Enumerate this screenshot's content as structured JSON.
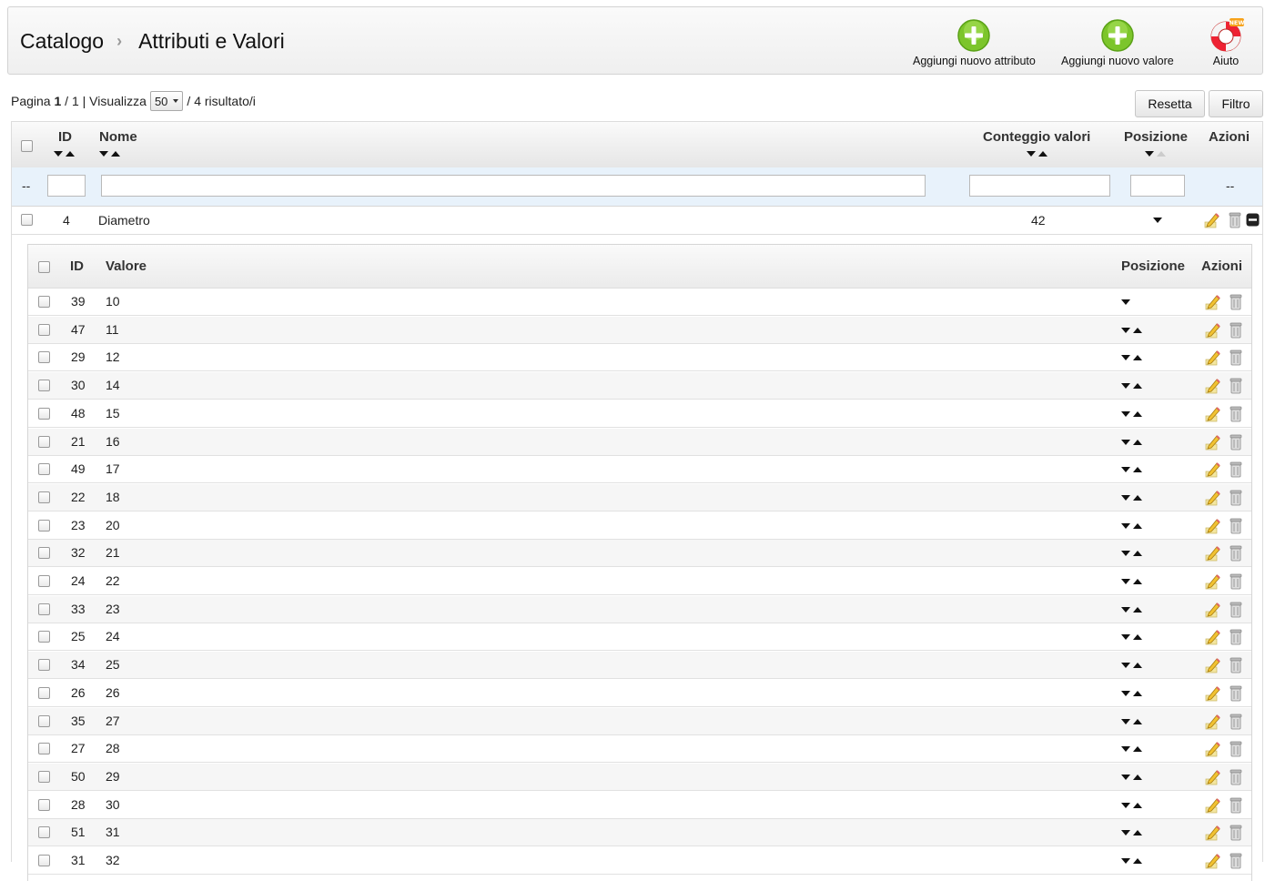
{
  "breadcrumb": {
    "section": "Catalogo",
    "page": "Attributi e Valori"
  },
  "toolbar": {
    "add_attribute": "Aggiungi nuovo attributo",
    "add_value": "Aggiungi nuovo valore",
    "help": "Aiuto",
    "help_badge": "NEW"
  },
  "pager": {
    "page_label": "Pagina",
    "page": "1",
    "total_pages": "/ 1",
    "view_label": "| Visualizza",
    "per_page": "50",
    "results": "/ 4 risultato/i"
  },
  "buttons": {
    "reset": "Resetta",
    "filter": "Filtro"
  },
  "grid": {
    "columns": {
      "id": "ID",
      "name": "Nome",
      "count": "Conteggio valori",
      "position": "Posizione",
      "actions": "Azioni"
    },
    "filter_placeholder_dash": "--",
    "actions_dash": "--",
    "row": {
      "id": "4",
      "name": "Diametro",
      "count": "42"
    }
  },
  "values_grid": {
    "columns": {
      "id": "ID",
      "value": "Valore",
      "position": "Posizione",
      "actions": "Azioni"
    },
    "rows": [
      {
        "id": "39",
        "value": "10"
      },
      {
        "id": "47",
        "value": "11"
      },
      {
        "id": "29",
        "value": "12"
      },
      {
        "id": "30",
        "value": "14"
      },
      {
        "id": "48",
        "value": "15"
      },
      {
        "id": "21",
        "value": "16"
      },
      {
        "id": "49",
        "value": "17"
      },
      {
        "id": "22",
        "value": "18"
      },
      {
        "id": "23",
        "value": "20"
      },
      {
        "id": "32",
        "value": "21"
      },
      {
        "id": "24",
        "value": "22"
      },
      {
        "id": "33",
        "value": "23"
      },
      {
        "id": "25",
        "value": "24"
      },
      {
        "id": "34",
        "value": "25"
      },
      {
        "id": "26",
        "value": "26"
      },
      {
        "id": "35",
        "value": "27"
      },
      {
        "id": "27",
        "value": "28"
      },
      {
        "id": "50",
        "value": "29"
      },
      {
        "id": "28",
        "value": "30"
      },
      {
        "id": "51",
        "value": "31"
      },
      {
        "id": "31",
        "value": "32"
      }
    ]
  },
  "icons": [
    "plus-icon",
    "help-lifebuoy-icon",
    "sort-down-icon",
    "sort-up-icon",
    "edit-pencil-icon",
    "delete-trash-icon",
    "collapse-icon"
  ],
  "colors": {
    "green": "#7cc52b",
    "filter_row": "#e8f2fb",
    "toolbar_border": "#d3d3d3"
  }
}
